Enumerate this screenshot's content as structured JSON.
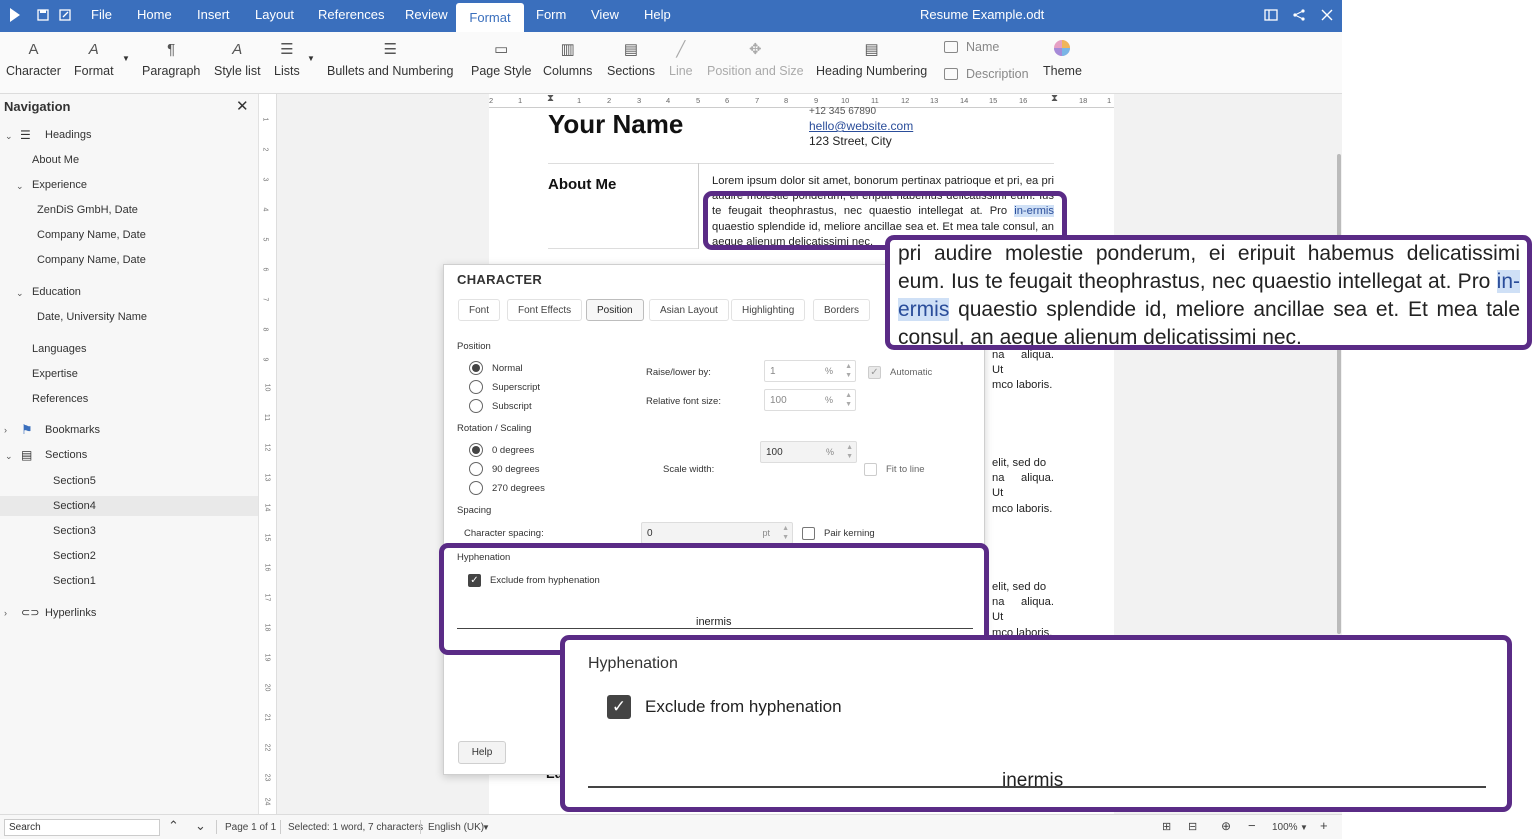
{
  "titlebar": {
    "menus": [
      "File",
      "Home",
      "Insert",
      "Layout",
      "References",
      "Review",
      "Format",
      "Form",
      "View",
      "Help"
    ],
    "active_menu": "Format",
    "document_title": "Resume Example.odt"
  },
  "toolbar": {
    "character": "Character",
    "format": "Format",
    "paragraph": "Paragraph",
    "style_list": "Style list",
    "lists": "Lists",
    "bullets": "Bullets and Numbering",
    "page_style": "Page Style",
    "columns": "Columns",
    "sections": "Sections",
    "line": "Line",
    "position_size": "Position and Size",
    "heading_numbering": "Heading Numbering",
    "name": "Name",
    "description": "Description",
    "theme": "Theme"
  },
  "navigation": {
    "title": "Navigation",
    "headings": "Headings",
    "about_me": "About Me",
    "experience": "Experience",
    "exp1": "ZenDiS GmbH, Date",
    "exp2": "Company Name, Date",
    "exp3": "Company Name, Date",
    "education": "Education",
    "edu1": "Date, University Name",
    "languages": "Languages",
    "expertise": "Expertise",
    "references": "References",
    "bookmarks": "Bookmarks",
    "sections": "Sections",
    "section5": "Section5",
    "section4": "Section4",
    "section3": "Section3",
    "section2": "Section2",
    "section1": "Section1",
    "hyperlinks": "Hyperlinks",
    "selected": "Section4"
  },
  "document": {
    "name": "Your Name",
    "phone": "+12 345 67890",
    "email": "hello@website.com",
    "address": "123 Street, City",
    "about_heading": "About Me",
    "about_text_a": "Lorem ipsum dolor sit amet, bonorum pertinax patrioque et pri, ea pri audire molestie ponderum, ei eripuit habemus delicatissimi eum. Ius te feugait theophrastus, nec quaestio intellegat at. Pro ",
    "about_hl1": "in-",
    "about_hl2": "ermis",
    "about_text_b": " quaestio splendide id, meliore ancillae sea et. Et mea tale consul, an aeque alienum delicatissimi nec.",
    "frag1a": "na aliqua. Ut",
    "frag1b": "mco laboris.",
    "frag2a": "elit, sed do",
    "frag2b": "na aliqua. Ut",
    "frag2c": "mco laboris.",
    "frag3a": "elit, sed do",
    "frag3b": "na aliqua. Ut",
    "frag3c": "mco laboris.",
    "frag4": "Ed"
  },
  "dialog": {
    "title": "CHARACTER",
    "tabs": [
      "Font",
      "Font Effects",
      "Position",
      "Asian Layout",
      "Highlighting",
      "Borders"
    ],
    "active_tab": "Position",
    "position_label": "Position",
    "normal": "Normal",
    "superscript": "Superscript",
    "subscript": "Subscript",
    "raise_lower": "Raise/lower by:",
    "raise_value": "1",
    "raise_unit": "%",
    "automatic": "Automatic",
    "rel_font_size": "Relative font size:",
    "rel_value": "100",
    "rel_unit": "%",
    "rotation_label": "Rotation / Scaling",
    "deg0": "0 degrees",
    "deg90": "90 degrees",
    "deg270": "270 degrees",
    "scale_width": "Scale width:",
    "scale_value": "100",
    "scale_unit": "%",
    "fit_to_line": "Fit to line",
    "spacing_label": "Spacing",
    "char_spacing": "Character spacing:",
    "spacing_value": "0",
    "spacing_unit": "pt",
    "pair_kerning": "Pair kerning",
    "hyphenation_label": "Hyphenation",
    "exclude": "Exclude from hyphenation",
    "preview_word": "inermis",
    "help": "Help"
  },
  "magnifier_text": {
    "l1": "pri audire molestie ponderum, ei eripuit habemus delicatissimi",
    "l2a": "eum. Ius te feugait theophrastus, nec quaestio intellegat at. Pro ",
    "l2hl": "in-",
    "l3hl": "ermis",
    "l3b": " quaestio splendide id, meliore ancillae sea et. Et mea tale",
    "l4": "consul, an aeque alienum delicatissimi nec."
  },
  "statusbar": {
    "search_value": "Search",
    "page": "Page 1 of 1",
    "selection": "Selected: 1 word, 7 characters",
    "language": "English (UK)",
    "zoom": "100%"
  },
  "colors": {
    "accent": "#3a6fbd",
    "callout": "#5a2b86",
    "highlight": "#cfe0f6"
  }
}
